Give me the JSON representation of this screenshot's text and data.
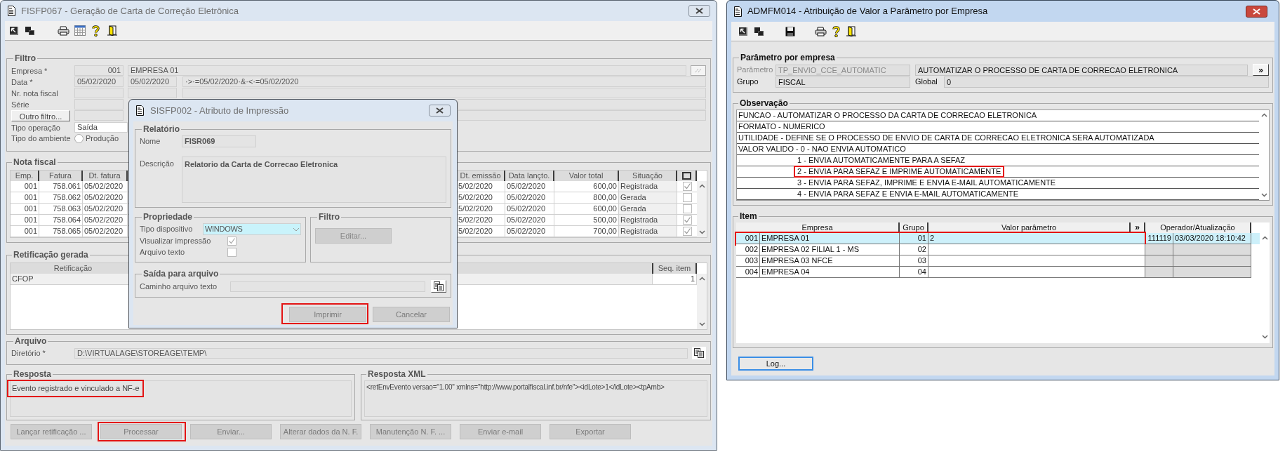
{
  "main_window": {
    "title": "FISFP067 - Geração de Carta de Correção Eletrônica",
    "active": false,
    "filter": {
      "title": "Filtro",
      "company": {
        "label": "Empresa *",
        "code": "001",
        "name": "EMPRESA 01"
      },
      "date": {
        "label": "Data *",
        "from": "05/02/2020",
        "to": "05/02/2020",
        "expression": "·>·=05/02/2020·&·<·=05/02/2020"
      },
      "invoice_number": {
        "label": "Nr. nota fiscal"
      },
      "series": {
        "label": "Série"
      },
      "other_filter_button": "Outro filtro...",
      "operation_type": {
        "label": "Tipo operação",
        "value": "Saída"
      },
      "environment": {
        "label": "Tipo do ambiente",
        "option": "Produção",
        "selected": false
      }
    },
    "invoices": {
      "title": "Nota fiscal",
      "columns": [
        "Emp.",
        "Fatura",
        "Dt. fatura",
        "Dt. emissão",
        "Data lançto.",
        "Valor total",
        "Situação"
      ],
      "rows": [
        {
          "emp": "001",
          "fatura": "758.061",
          "dt_fatura": "05/02/2020",
          "dt_emissao": "5/02/2020",
          "data_lancto": "05/02/2020",
          "valor_total": "600,00",
          "situacao": "Registrada",
          "checked": true
        },
        {
          "emp": "001",
          "fatura": "758.062",
          "dt_fatura": "05/02/2020",
          "dt_emissao": "5/02/2020",
          "data_lancto": "05/02/2020",
          "valor_total": "800,00",
          "situacao": "Gerada",
          "checked": false
        },
        {
          "emp": "001",
          "fatura": "758.063",
          "dt_fatura": "05/02/2020",
          "dt_emissao": "5/02/2020",
          "data_lancto": "05/02/2020",
          "valor_total": "600,00",
          "situacao": "Gerada",
          "checked": false
        },
        {
          "emp": "001",
          "fatura": "758.064",
          "dt_fatura": "05/02/2020",
          "dt_emissao": "5/02/2020",
          "data_lancto": "05/02/2020",
          "valor_total": "500,00",
          "situacao": "Registrada",
          "checked": true
        },
        {
          "emp": "001",
          "fatura": "758.065",
          "dt_fatura": "05/02/2020",
          "dt_emissao": "5/02/2020",
          "data_lancto": "05/02/2020",
          "valor_total": "700,00",
          "situacao": "Registrada",
          "checked": true
        }
      ]
    },
    "corrections": {
      "title": "Retificação gerada",
      "columns": [
        "Retificação",
        "Seq. item"
      ],
      "rows": [
        {
          "retificacao": "CFOP",
          "seq_item": "1"
        }
      ]
    },
    "file": {
      "title": "Arquivo",
      "label": "Diretório *",
      "value": "D:\\VIRTUALAGE\\STOREAGE\\TEMP\\"
    },
    "response": {
      "title": "Resposta",
      "text": "Evento registrado e vinculado a NF-e",
      "highlighted": true
    },
    "response_xml": {
      "title": "Resposta XML",
      "text": "<retEnvEvento versao=\"1.00\" xmlns=\"http://www.portalfiscal.inf.br/nfe\"><idLote>1</idLote><tpAmb>"
    },
    "buttons": [
      {
        "label": "Lançar retificação ...",
        "highlighted": false
      },
      {
        "label": "Processar",
        "highlighted": true
      },
      {
        "label": "Enviar...",
        "highlighted": false
      },
      {
        "label": "Alterar dados da N. F.",
        "highlighted": false
      },
      {
        "label": "Manutenção N. F. ...",
        "highlighted": false
      },
      {
        "label": "Enviar e-mail",
        "highlighted": false
      },
      {
        "label": "Exportar",
        "highlighted": false
      }
    ]
  },
  "print_dialog": {
    "title": "SISFP002 - Atributo de Impressão",
    "report": {
      "title": "Relatório",
      "name_label": "Nome",
      "name": "FISR069",
      "description_label": "Descrição",
      "description": "Relatorio da Carta de Correcao Eletronica"
    },
    "properties": {
      "title": "Propriedade",
      "device_label": "Tipo dispositivo",
      "device": "WINDOWS",
      "preview_label": "Visualizar impressão",
      "preview_checked": true,
      "text_file_label": "Arquivo texto",
      "text_file_checked": false
    },
    "filter": {
      "title": "Filtro",
      "edit_button": "Editar..."
    },
    "output": {
      "title": "Saída para arquivo",
      "path_label": "Caminho arquivo texto"
    },
    "buttons": [
      {
        "label": "Imprimir",
        "highlighted": true
      },
      {
        "label": "Cancelar",
        "highlighted": false
      }
    ]
  },
  "parameter_window": {
    "title": "ADMFM014 - Atribuição de Valor a Parâmetro por Empresa",
    "active": true,
    "parameter": {
      "title": "Parâmetro por empresa",
      "parameter_label": "Parâmetro",
      "parameter": "TP_ENVIO_CCE_AUTOMATIC",
      "description": "AUTOMATIZAR O PROCESSO DE CARTA DE CORRECAO ELETRONICA",
      "expand_button": "»",
      "group_label": "Grupo",
      "group": "FISCAL",
      "global_label": "Global",
      "global": "0"
    },
    "observation": {
      "title": "Observação",
      "lines": [
        {
          "kind": "main",
          "text": "FUNCAO -  AUTOMATIZAR O PROCESSO DA CARTA DE CORRECAO ELETRONICA",
          "highlighted": false
        },
        {
          "kind": "main",
          "text": "FORMATO - NUMERICO",
          "highlighted": false
        },
        {
          "kind": "main",
          "text": "UTILIDADE - DEFINE SE O PROCESSO DE ENVIO DE CARTA DE CORRECAO ELETRONICA SERA AUTOMATIZADA",
          "highlighted": false
        },
        {
          "kind": "main",
          "text": "VALOR VALIDO - 0 - NAO ENVIA AUTOMATICO",
          "highlighted": false
        },
        {
          "kind": "sub",
          "text": "1 - ENVIA AUTOMATICAMENTE PARA A SEFAZ",
          "highlighted": false
        },
        {
          "kind": "sub",
          "text": "2 - ENVIA PARA SEFAZ E IMPRIME AUTOMATICAMENTE",
          "highlighted": true
        },
        {
          "kind": "sub",
          "text": "3 - ENVIA PARA SEFAZ, IMPRIME E ENVIA E-MAIL AUTOMATICAMENTE",
          "highlighted": false
        },
        {
          "kind": "sub",
          "text": "4 - ENVIA PARA SEFAZ E ENVIA E-MAIL AUTOMATICAMENTE",
          "highlighted": false
        }
      ]
    },
    "items": {
      "title": "Item",
      "columns": [
        "Empresa",
        "Grupo",
        "Valor parâmetro",
        "»",
        "Operador/Atualização"
      ],
      "rows": [
        {
          "code": "001",
          "company": "EMPRESA 01",
          "group": "01",
          "value": "2",
          "operator": "111119",
          "updated": "03/03/2020 18:10:42",
          "selected": true,
          "highlighted": true
        },
        {
          "code": "002",
          "company": "EMPRESA 02 FILIAL 1 - MS",
          "group": "02",
          "selected": false,
          "highlighted": false
        },
        {
          "code": "003",
          "company": "EMPRESA 03 NFCE",
          "group": "03",
          "selected": false,
          "highlighted": false
        },
        {
          "code": "004",
          "company": "EMPRESA 04",
          "group": "04",
          "selected": false,
          "highlighted": false
        }
      ]
    },
    "log_button": "Log..."
  }
}
